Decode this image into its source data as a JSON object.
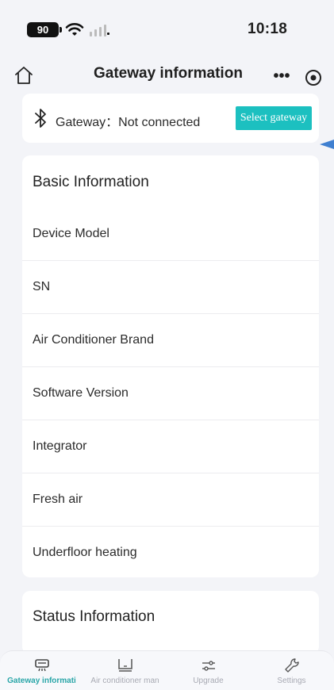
{
  "status_bar": {
    "battery": "90",
    "time": "10:18"
  },
  "nav": {
    "title": "Gateway information",
    "more": "•••"
  },
  "gateway": {
    "label": "Gateway：Not connected",
    "select_button": "Select gateway"
  },
  "basic_info": {
    "title": "Basic Information",
    "rows": [
      "Device Model",
      "SN",
      "Air Conditioner Brand",
      "Software Version",
      "Integrator",
      "Fresh air",
      "Underfloor heating"
    ]
  },
  "status_info": {
    "title": "Status Information"
  },
  "tabs": [
    {
      "label": "Gateway informati",
      "icon": "gateway-icon",
      "active": true
    },
    {
      "label": "Air conditioner man",
      "icon": "air-conditioner-icon",
      "active": false
    },
    {
      "label": "Upgrade",
      "icon": "upgrade-icon",
      "active": false
    },
    {
      "label": "Settings",
      "icon": "wrench-icon",
      "active": false
    }
  ],
  "colors": {
    "accent": "#1cc0c0",
    "tab_active": "#2aa6a8",
    "background": "#f3f4f8",
    "marker": "#3f7fd0"
  }
}
